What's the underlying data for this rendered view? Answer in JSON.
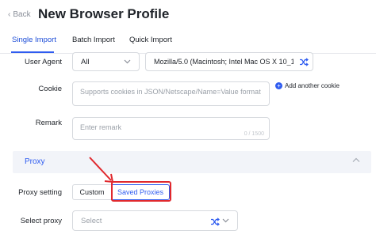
{
  "header": {
    "back_label": "Back",
    "title": "New Browser Profile"
  },
  "tabs": [
    {
      "label": "Single Import",
      "active": true
    },
    {
      "label": "Batch Import",
      "active": false
    },
    {
      "label": "Quick Import",
      "active": false
    }
  ],
  "user_agent": {
    "label": "User Agent",
    "platform_value": "All",
    "ua_value": "Mozilla/5.0 (Macintosh; Intel Mac OS X 10_14_..."
  },
  "cookie": {
    "label": "Cookie",
    "placeholder": "Supports cookies in JSON/Netscape/Name=Value format",
    "add_another_label": "Add another cookie"
  },
  "remark": {
    "label": "Remark",
    "placeholder": "Enter remark",
    "counter": "0 / 1500"
  },
  "proxy_section": {
    "title": "Proxy"
  },
  "proxy_setting": {
    "label": "Proxy setting",
    "options": [
      "Custom",
      "Saved Proxies"
    ],
    "selected": "Saved Proxies"
  },
  "select_proxy": {
    "label": "Select proxy",
    "placeholder": "Select"
  },
  "colors": {
    "accent": "#2f5cf0",
    "annotation": "#e0292e"
  }
}
